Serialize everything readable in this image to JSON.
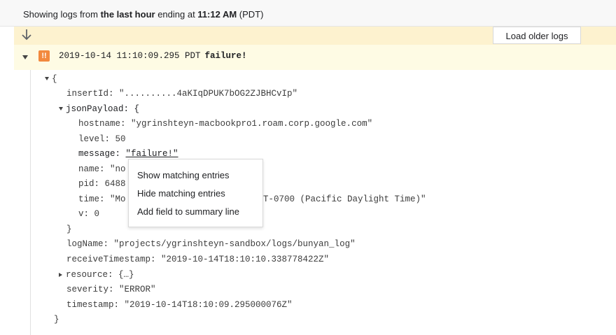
{
  "banner": {
    "prefix": "Showing logs from ",
    "range": "the last hour",
    "middle": " ending at ",
    "time": "11:12 AM",
    "suffix": " (PDT)"
  },
  "toolbar": {
    "scroll_icon": "arrow-down-icon",
    "load_older_label": "Load older logs"
  },
  "entry": {
    "severity_badge": "!!",
    "severity_icon": "error-severity-icon",
    "timestamp": "2019-10-14 11:10:09.295 PDT",
    "message": "failure!",
    "badge_color": "#f2893e"
  },
  "payload": {
    "open_brace": "{",
    "insert_id": "insertId: \"..........4aKIqDPUK7bOG2ZJBHCvIp\"",
    "json_payload_key": "jsonPayload: {",
    "hostname": "hostname: \"ygrinshteyn-macbookpro1.roam.corp.google.com\"",
    "level": "level: 50",
    "message_key": "message: ",
    "message_value": "\"failure!\"",
    "name": "name: \"no",
    "pid": "pid: 6488",
    "time_start": "time: \"Mo",
    "time_end": "T-0700 (Pacific Daylight Time)\"",
    "v": "v: 0",
    "json_close": "}",
    "log_name": "logName: \"projects/ygrinshteyn-sandbox/logs/bunyan_log\"",
    "receive_timestamp": "receiveTimestamp: \"2019-10-14T18:10:10.338778422Z\"",
    "resource": "resource: {…}",
    "severity": "severity: \"ERROR\"",
    "timestamp": "timestamp: \"2019-10-14T18:10:09.295000076Z\"",
    "close_brace": "}"
  },
  "context_menu": {
    "items": [
      "Show matching entries",
      "Hide matching entries",
      "Add field to summary line"
    ]
  }
}
